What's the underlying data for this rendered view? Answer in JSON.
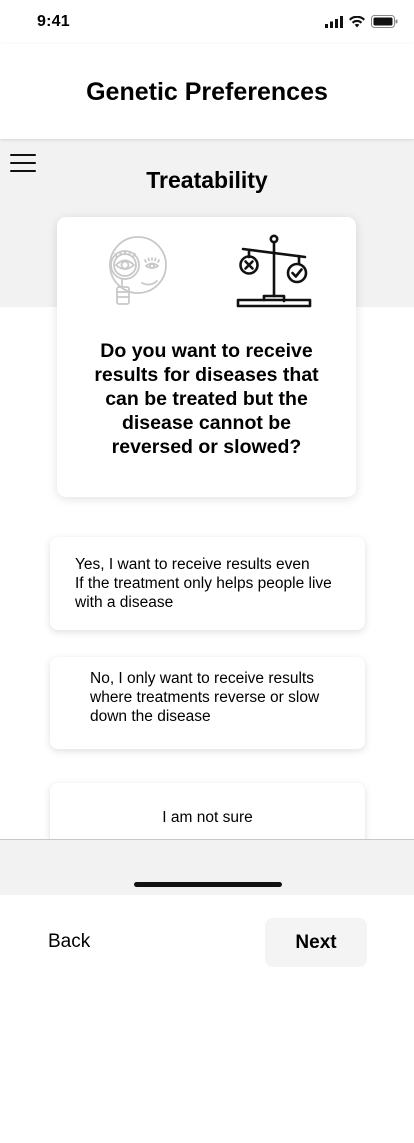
{
  "status_bar": {
    "time": "9:41"
  },
  "header": {
    "title": "Genetic Preferences"
  },
  "section": {
    "title": "Treatability"
  },
  "question": {
    "text": "Do you want to receive results for diseases that can be treated but the disease cannot be reversed or slowed?",
    "icons": [
      "magnifier-eye-icon",
      "balance-scale-icon"
    ]
  },
  "options": [
    {
      "line1": "Yes, I want to receive results even",
      "line2": "If the treatment only helps people live",
      "line3": "with a disease"
    },
    {
      "line1": "No, I only want to receive results",
      "line2": "where treatments reverse or slow",
      "line3": "down the disease"
    },
    {
      "line1": "I am not sure"
    }
  ],
  "nav": {
    "back_label": "Back",
    "next_label": "Next"
  },
  "colors": {
    "background": "#ffffff",
    "band": "#f2f2f2",
    "text": "#000000"
  }
}
